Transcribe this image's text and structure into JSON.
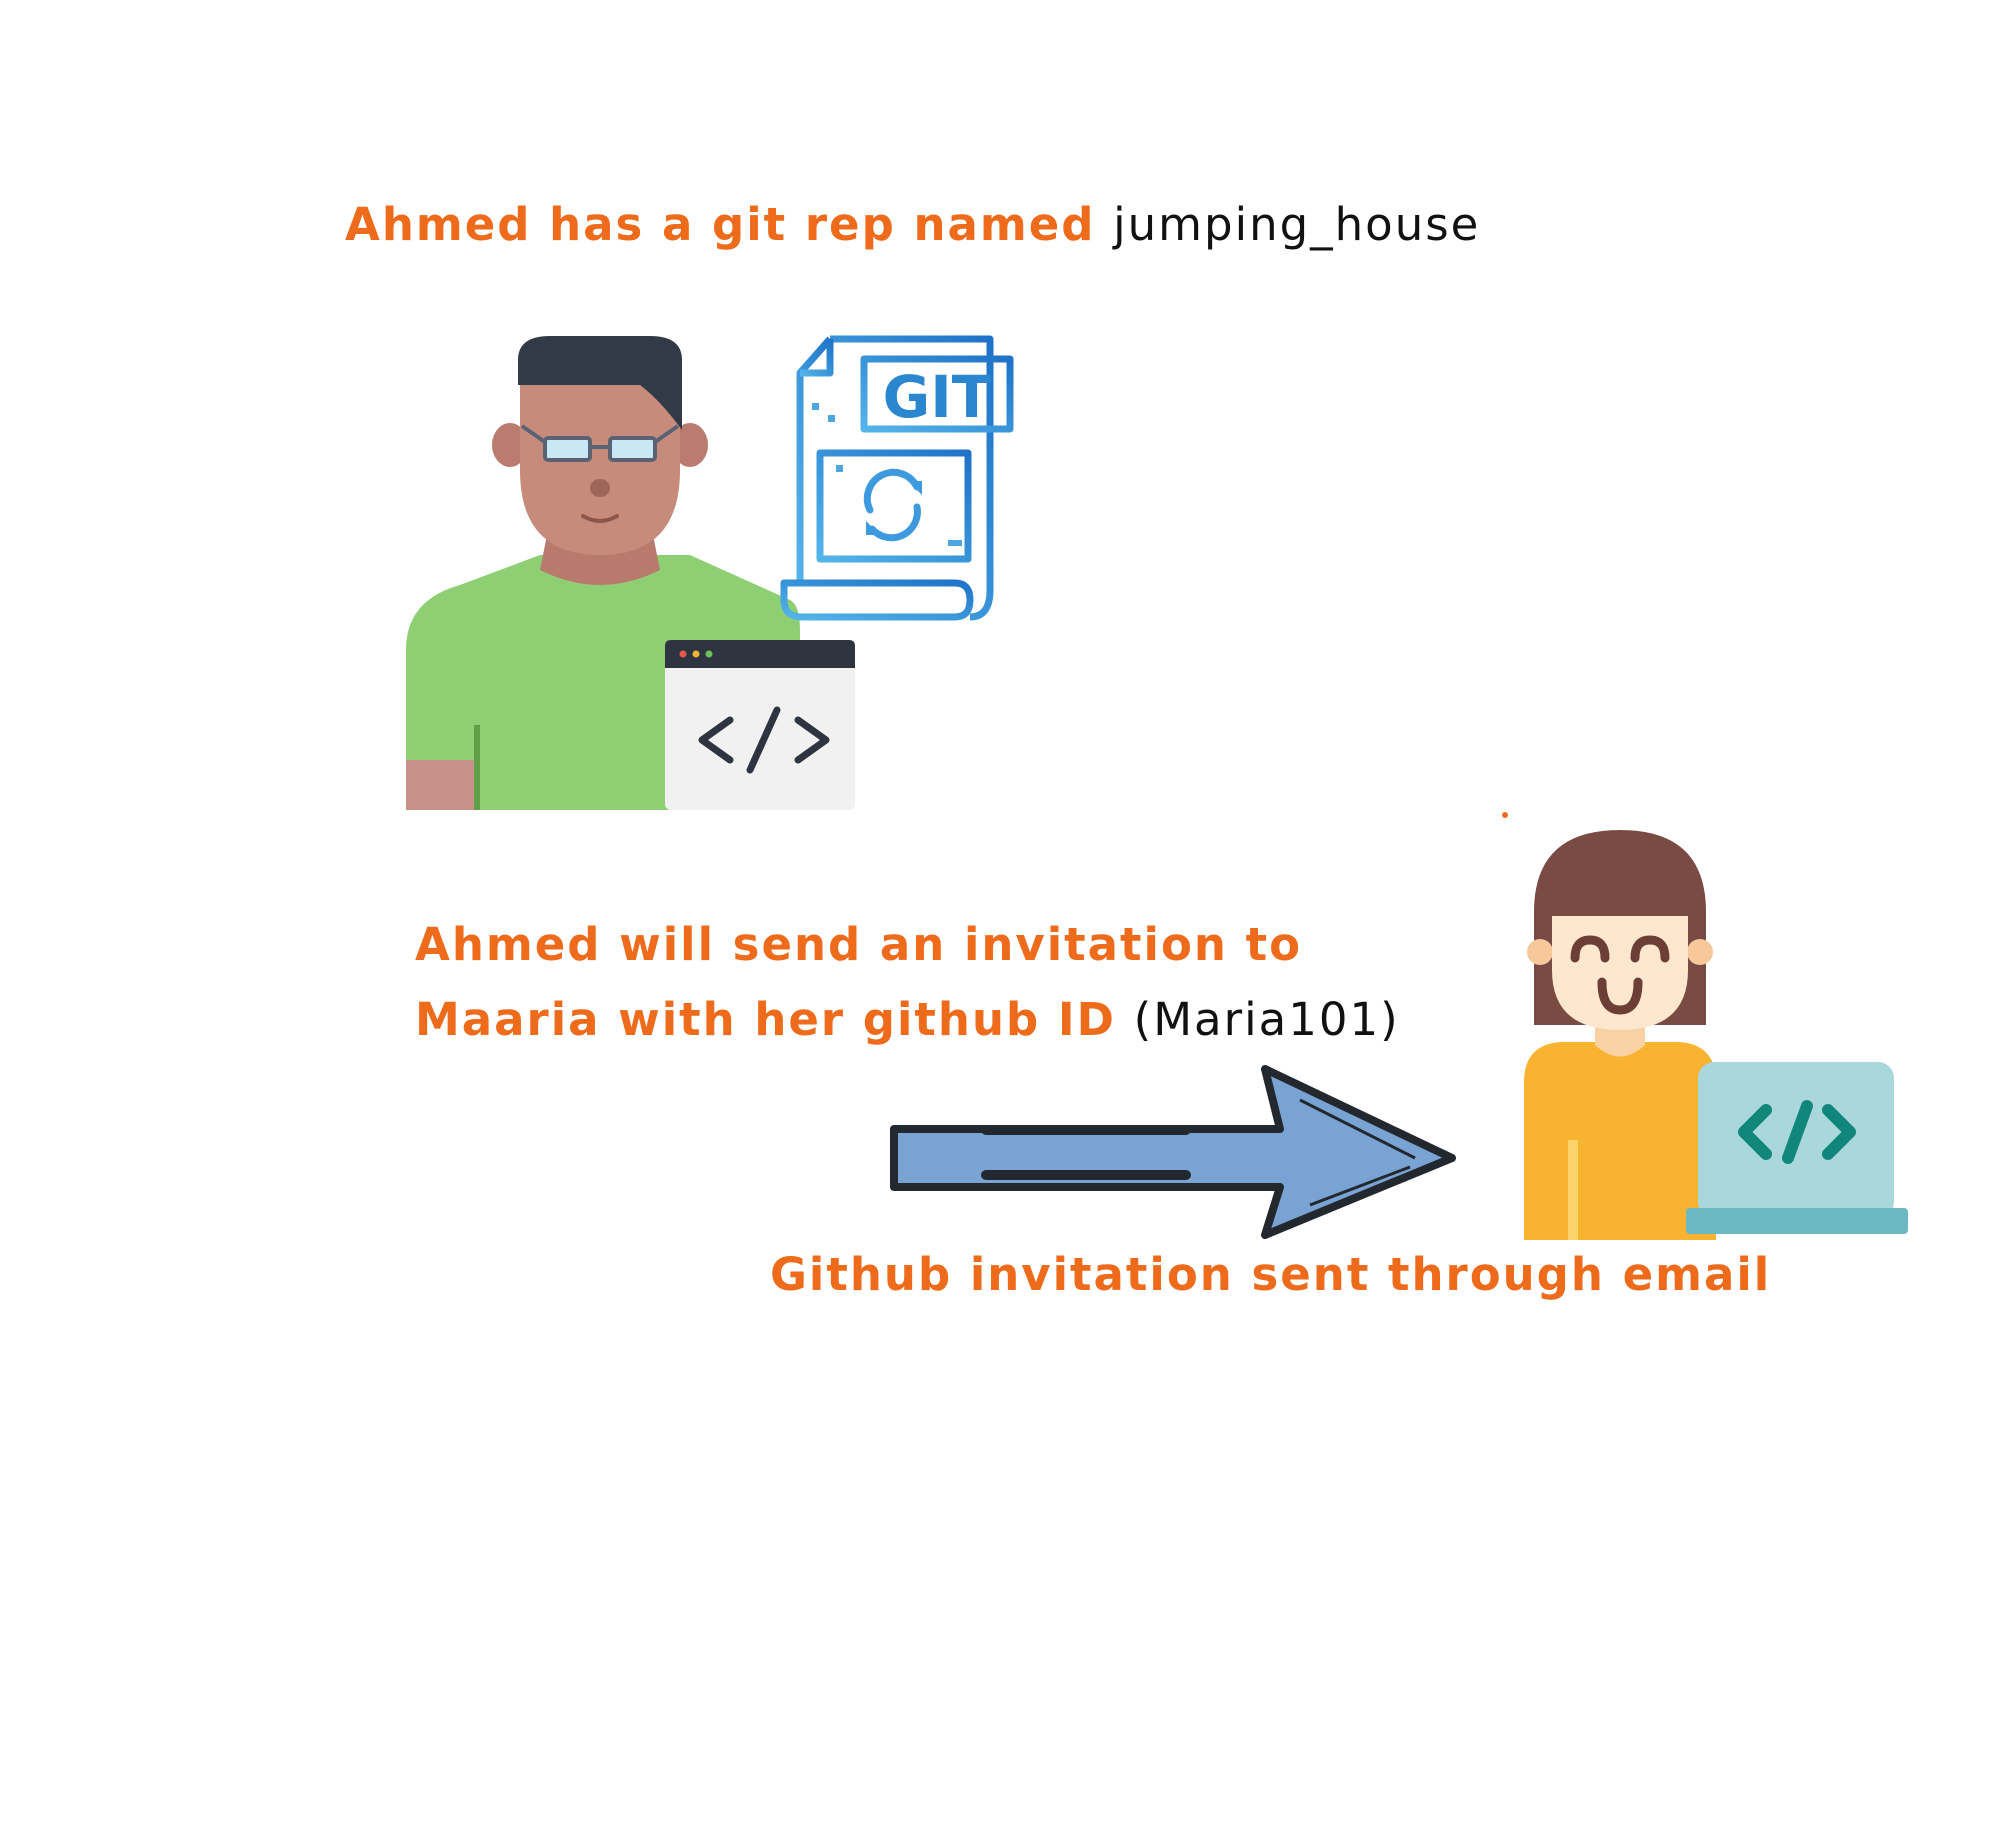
{
  "captions": {
    "repo": {
      "prefix": "Ahmed has a git rep named",
      "repo_name": "jumping_house"
    },
    "invite": {
      "line1": "Ahmed will send an invitation to",
      "line2_prefix": "Maaria with her github ID",
      "github_id": "(Maria101)"
    },
    "email": "Github invitation sent through email"
  },
  "icons": {
    "git_file_label": "GIT"
  },
  "colors": {
    "caption": "#ee6b1b",
    "highlight": "#111111",
    "arrow_fill": "#78a3d3",
    "git_blue": "#2a86cf"
  }
}
